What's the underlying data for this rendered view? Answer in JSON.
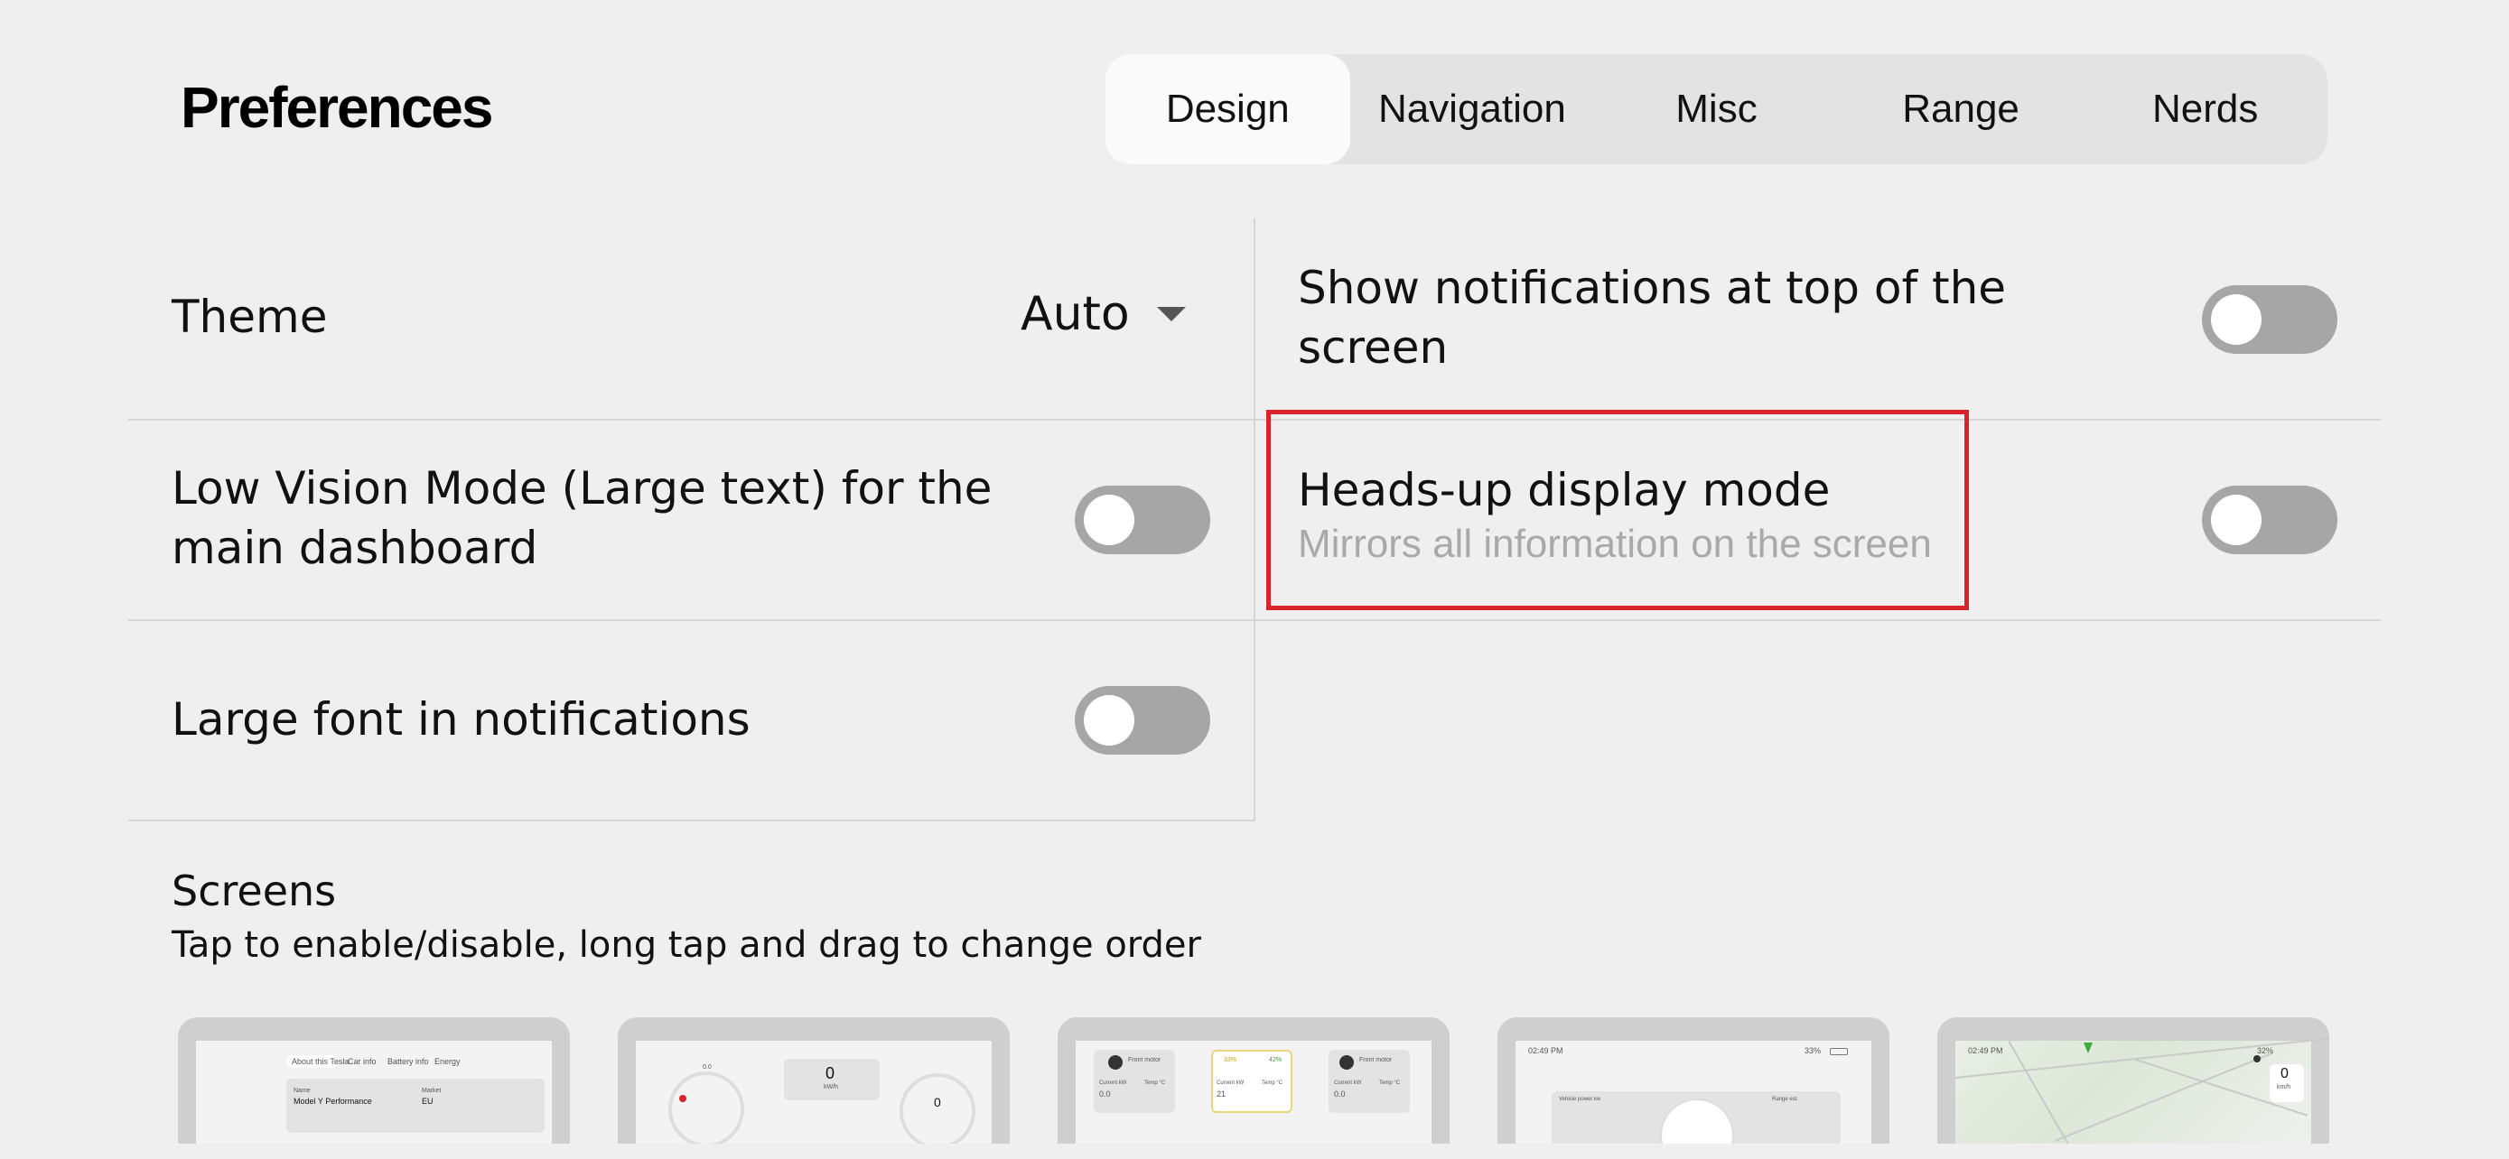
{
  "header": {
    "title": "Preferences"
  },
  "tabs": [
    "Design",
    "Navigation",
    "Misc",
    "Range",
    "Nerds"
  ],
  "active_tab": "Design",
  "settings_left": {
    "theme": {
      "label": "Theme",
      "value": "Auto"
    },
    "low_vision": {
      "label_line1": "Low Vision Mode (Large text) for the",
      "label_line2": "main dashboard",
      "enabled": false
    },
    "large_font": {
      "label": "Large font in notifications",
      "enabled": false
    }
  },
  "settings_right": {
    "notifications_top": {
      "label_line1": "Show notifications at top of the",
      "label_line2": "screen",
      "enabled": false
    },
    "hud": {
      "label": "Heads-up display mode",
      "subtitle": "Mirrors all information on the screen",
      "enabled": false
    }
  },
  "screens": {
    "title": "Screens",
    "description": "Tap to enable/disable, long tap and drag to change order",
    "thumbs": [
      {
        "tabs": [
          "About this Tesla",
          "Car info",
          "Battery info",
          "Energy"
        ],
        "field_label": "Name",
        "field_label2": "Market",
        "field_value": "Model Y Performance",
        "field_value2": "EU"
      },
      {
        "gauge_left": "0.0",
        "center_value": "0",
        "center_unit": "kW/h",
        "right_value": "0"
      },
      {
        "left_label": "Front motor",
        "mid_left": "33%",
        "mid_right": "42%",
        "right_label": "Front motor",
        "cols": [
          "Current kW",
          "Temp °C"
        ],
        "vals": [
          "0.0",
          "21",
          "0.0"
        ]
      },
      {
        "time": "02:49 PM",
        "battery": "33%",
        "label_left": "Vehicle power kw",
        "label_right": "Range est."
      },
      {
        "time": "02:49 PM",
        "battery": "32%",
        "speed": "0",
        "unit": "km/h"
      }
    ]
  }
}
